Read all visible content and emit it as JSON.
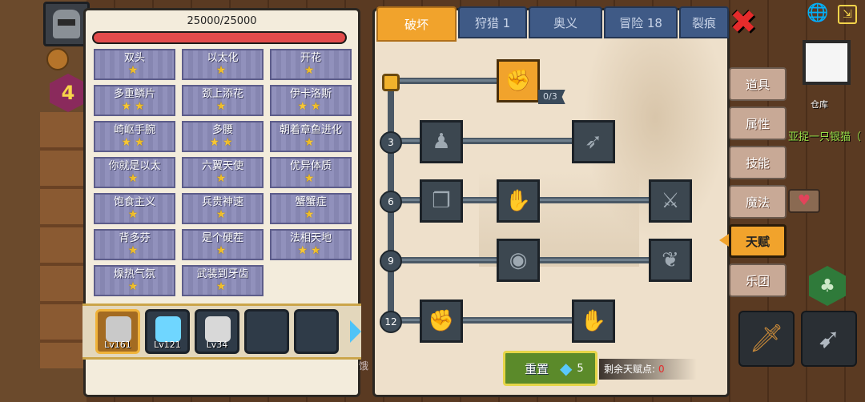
{
  "hp": {
    "text": "25000/25000",
    "fraction": 1.0
  },
  "level_badge": "4",
  "talents": [
    {
      "name": "双头",
      "stars": "★"
    },
    {
      "name": "以太化",
      "stars": "★"
    },
    {
      "name": "开花",
      "stars": "★"
    },
    {
      "name": "多重鳞片",
      "stars": "★★"
    },
    {
      "name": "颈上添花",
      "stars": "★"
    },
    {
      "name": "伊卡洛斯",
      "stars": "★★"
    },
    {
      "name": "崎岖手腕",
      "stars": "★★"
    },
    {
      "name": "多腰",
      "stars": "★★"
    },
    {
      "name": "朝着章鱼进化",
      "stars": "★"
    },
    {
      "name": "你就是以太",
      "stars": "★"
    },
    {
      "name": "六翼天使",
      "stars": "★"
    },
    {
      "name": "优异体质",
      "stars": "★"
    },
    {
      "name": "饱食主义",
      "stars": "★"
    },
    {
      "name": "兵贵神速",
      "stars": "★"
    },
    {
      "name": "蟹蟹症",
      "stars": "★"
    },
    {
      "name": "背多芬",
      "stars": "★"
    },
    {
      "name": "是个硬茬",
      "stars": "★"
    },
    {
      "name": "法相天地",
      "stars": "★★"
    },
    {
      "name": "燥热气氛",
      "stars": "★"
    },
    {
      "name": "武装到牙齿",
      "stars": "★"
    }
  ],
  "heroes": [
    {
      "level": "Lv161",
      "color": "#c9c9c9"
    },
    {
      "level": "Lv121",
      "color": "#6fd6ff"
    },
    {
      "level": "Lv34",
      "color": "#d8d8d8"
    },
    {
      "level": "",
      "color": ""
    },
    {
      "level": "",
      "color": ""
    }
  ],
  "tabs": [
    "破坏",
    "狩猎 1",
    "奥义",
    "冒险 18",
    "裂痕"
  ],
  "tree": {
    "root_progress": "0/3",
    "tiers": [
      "3",
      "6",
      "9",
      "12"
    ]
  },
  "reset": {
    "label": "重置",
    "cost": "5"
  },
  "remaining": {
    "label": "剩余天赋点:",
    "value": "0"
  },
  "side_menu": [
    "道具",
    "属性",
    "技能",
    "魔法",
    "天赋",
    "乐团"
  ],
  "world": {
    "warehouse": "仓库",
    "ticker": "亚捉一只银猫（",
    "bottom_text": "饿"
  },
  "icons": {
    "close": "close-icon",
    "globe": "globe-icon",
    "diamond": "diamond-icon",
    "heart": "heart-icon"
  },
  "colors": {
    "accent": "#f1a32c",
    "hp": "#e24b4b",
    "panel": "#f3ecdc",
    "tab": "#3f5a86"
  }
}
